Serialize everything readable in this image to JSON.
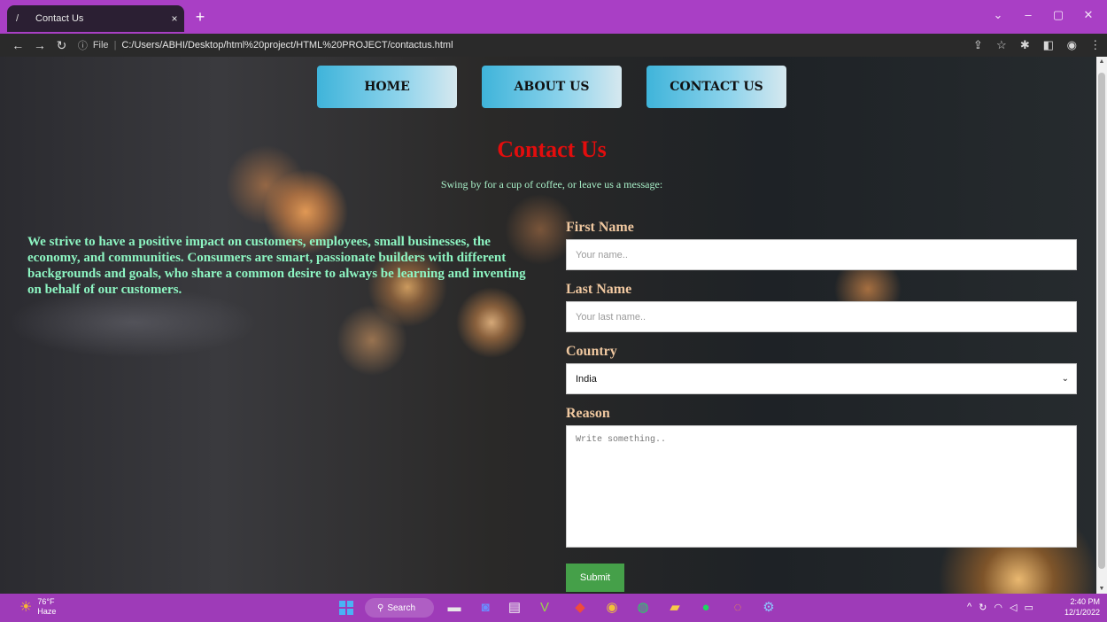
{
  "browser": {
    "tab_title": "Contact Us",
    "tab_close": "×",
    "new_tab": "+",
    "url_info": "ⓘ",
    "url_scheme": "File",
    "url_separator": "|",
    "url_path": "C:/Users/ABHI/Desktop/html%20project/HTML%20PROJECT/contactus.html"
  },
  "nav": {
    "home": "HOME",
    "about": "ABOUT US",
    "contact": "CONTACT US"
  },
  "page": {
    "heading": "Contact Us",
    "subheading": "Swing by for a cup of coffee, or leave us a message:",
    "about_text": "We strive to have a positive impact on customers, employees, small businesses, the economy, and communities. Consumers are smart, passionate builders with different backgrounds and goals, who share a common desire to always be learning and inventing on behalf of our customers."
  },
  "form": {
    "first_name_label": "First Name",
    "first_name_placeholder": "Your name..",
    "last_name_label": "Last Name",
    "last_name_placeholder": "Your last name..",
    "country_label": "Country",
    "country_value": "India",
    "reason_label": "Reason",
    "reason_placeholder": "Write something..",
    "submit_label": "Submit"
  },
  "taskbar": {
    "temperature": "76°F",
    "weather": "Haze",
    "search_label": "Search",
    "time": "2:40 PM",
    "date": "12/1/2022"
  },
  "colors": {
    "tab_bar": "#a93fc5",
    "heading": "#e30d0d",
    "body_text": "#8df5c2",
    "label": "#f0c8a0",
    "submit": "#45a049",
    "taskbar": "#9e3bb8"
  }
}
